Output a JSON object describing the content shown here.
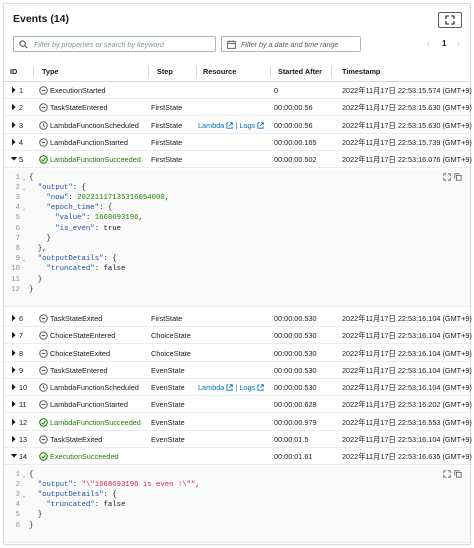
{
  "header": {
    "title": "Events (14)"
  },
  "filters": {
    "search_placeholder": "Filter by properties or search by keyword",
    "date_placeholder": "Filter by a date and time range"
  },
  "pagination": {
    "prev": "‹",
    "page": "1",
    "next": "›"
  },
  "columns": [
    "ID",
    "Type",
    "Step",
    "Resource",
    "Started After",
    "Timestamp"
  ],
  "resource_links": {
    "lambda": "Lambda",
    "separator": "|",
    "logs": "Logs"
  },
  "rows": [
    {
      "id": "1",
      "type": "ExecutionStarted",
      "status": "neutral",
      "expanded": false,
      "step": "",
      "resource": false,
      "started": "0",
      "timestamp": "2022年11月17日 22:53:15.574 (GMT+9)"
    },
    {
      "id": "2",
      "type": "TaskStateEntered",
      "status": "neutral",
      "expanded": false,
      "step": "FirstState",
      "resource": false,
      "started": "00:00:00.56",
      "timestamp": "2022年11月17日 22:53:15.630 (GMT+9)"
    },
    {
      "id": "3",
      "type": "LambdaFunctionScheduled",
      "status": "scheduled",
      "expanded": false,
      "step": "FirstState",
      "resource": true,
      "started": "00:00:00.56",
      "timestamp": "2022年11月17日 22:53:15.630 (GMT+9)"
    },
    {
      "id": "4",
      "type": "LambdaFunctionStarted",
      "status": "neutral",
      "expanded": false,
      "step": "FirstState",
      "resource": false,
      "started": "00:00:00.165",
      "timestamp": "2022年11月17日 22:53:15.739 (GMT+9)"
    },
    {
      "id": "5",
      "type": "LambdaFunctionSucceeded",
      "status": "success",
      "expanded": true,
      "step": "FirstState",
      "resource": false,
      "started": "00:00:00.502",
      "timestamp": "2022年11月17日 22:53:16.076 (GMT+9)"
    },
    {
      "id": "6",
      "type": "TaskStateExited",
      "status": "neutral",
      "expanded": false,
      "step": "FirstState",
      "resource": false,
      "started": "00:00:00.530",
      "timestamp": "2022年11月17日 22:53:16.104 (GMT+9)"
    },
    {
      "id": "7",
      "type": "ChoiceStateEntered",
      "status": "neutral",
      "expanded": false,
      "step": "ChoiceState",
      "resource": false,
      "started": "00:00:00.530",
      "timestamp": "2022年11月17日 22:53:16.104 (GMT+9)"
    },
    {
      "id": "8",
      "type": "ChoiceStateExited",
      "status": "neutral",
      "expanded": false,
      "step": "ChoiceState",
      "resource": false,
      "started": "00:00:00.530",
      "timestamp": "2022年11月17日 22:53:16.104 (GMT+9)"
    },
    {
      "id": "9",
      "type": "TaskStateEntered",
      "status": "neutral",
      "expanded": false,
      "step": "EvenState",
      "resource": false,
      "started": "00:00:00.530",
      "timestamp": "2022年11月17日 22:53:16.104 (GMT+9)"
    },
    {
      "id": "10",
      "type": "LambdaFunctionScheduled",
      "status": "scheduled",
      "expanded": false,
      "step": "EvenState",
      "resource": true,
      "started": "00:00:00.530",
      "timestamp": "2022年11月17日 22:53:16.104 (GMT+9)"
    },
    {
      "id": "11",
      "type": "LambdaFunctionStarted",
      "status": "neutral",
      "expanded": false,
      "step": "EvenState",
      "resource": false,
      "started": "00:00:00.628",
      "timestamp": "2022年11月17日 22:53:16.202 (GMT+9)"
    },
    {
      "id": "12",
      "type": "LambdaFunctionSucceeded",
      "status": "success",
      "expanded": false,
      "step": "EvenState",
      "resource": false,
      "started": "00:00:00.979",
      "timestamp": "2022年11月17日 22:53:16.553 (GMT+9)"
    },
    {
      "id": "13",
      "type": "TaskStateExited",
      "status": "neutral",
      "expanded": false,
      "step": "EvenState",
      "resource": false,
      "started": "00:00:01.5",
      "timestamp": "2022年11月17日 22:53:16.104 (GMT+9)"
    },
    {
      "id": "14",
      "type": "ExecutionSucceeded",
      "status": "success",
      "expanded": true,
      "step": "",
      "resource": false,
      "started": "00:00:01.61",
      "timestamp": "2022年11月17日 22:53:16.635 (GMT+9)"
    }
  ],
  "code_blocks": [
    {
      "lines": [
        {
          "n": "1",
          "fold": "⌄",
          "html": "{"
        },
        {
          "n": "2",
          "fold": "⌄",
          "html": "  <span class=\"k\">\"output\"</span>: {"
        },
        {
          "n": "3",
          "fold": "",
          "html": "    <span class=\"k\">\"now\"</span>: <span class=\"n\">20221117135316054000</span>,"
        },
        {
          "n": "4",
          "fold": "⌄",
          "html": "    <span class=\"k\">\"epoch_time\"</span>: {"
        },
        {
          "n": "5",
          "fold": "",
          "html": "      <span class=\"k\">\"value\"</span>: <span class=\"n\">1668693196</span>,"
        },
        {
          "n": "6",
          "fold": "",
          "html": "      <span class=\"k\">\"is_even\"</span>: <span class=\"b\">true</span>"
        },
        {
          "n": "7",
          "fold": "",
          "html": "    }"
        },
        {
          "n": "8",
          "fold": "",
          "html": "  },"
        },
        {
          "n": "9",
          "fold": "⌄",
          "html": "  <span class=\"k\">\"outputDetails\"</span>: {"
        },
        {
          "n": "10",
          "fold": "",
          "html": "    <span class=\"k\">\"truncated\"</span>: <span class=\"b\">false</span>"
        },
        {
          "n": "11",
          "fold": "",
          "html": "  }"
        },
        {
          "n": "12",
          "fold": "",
          "html": "}"
        }
      ]
    },
    {
      "lines": [
        {
          "n": "1",
          "fold": "⌄",
          "html": "{"
        },
        {
          "n": "2",
          "fold": "",
          "html": "  <span class=\"k\">\"output\"</span>: <span class=\"s2\">\"\\\"1668693196 is even !\\\"\"</span>,"
        },
        {
          "n": "3",
          "fold": "⌄",
          "html": "  <span class=\"k\">\"outputDetails\"</span>: {"
        },
        {
          "n": "4",
          "fold": "",
          "html": "    <span class=\"k\">\"truncated\"</span>: <span class=\"b\">false</span>"
        },
        {
          "n": "5",
          "fold": "",
          "html": "  }"
        },
        {
          "n": "6",
          "fold": "",
          "html": "}"
        }
      ]
    }
  ],
  "colors": {
    "success": "#1d8102",
    "link": "#0073bb",
    "neutral": "#545b64"
  }
}
